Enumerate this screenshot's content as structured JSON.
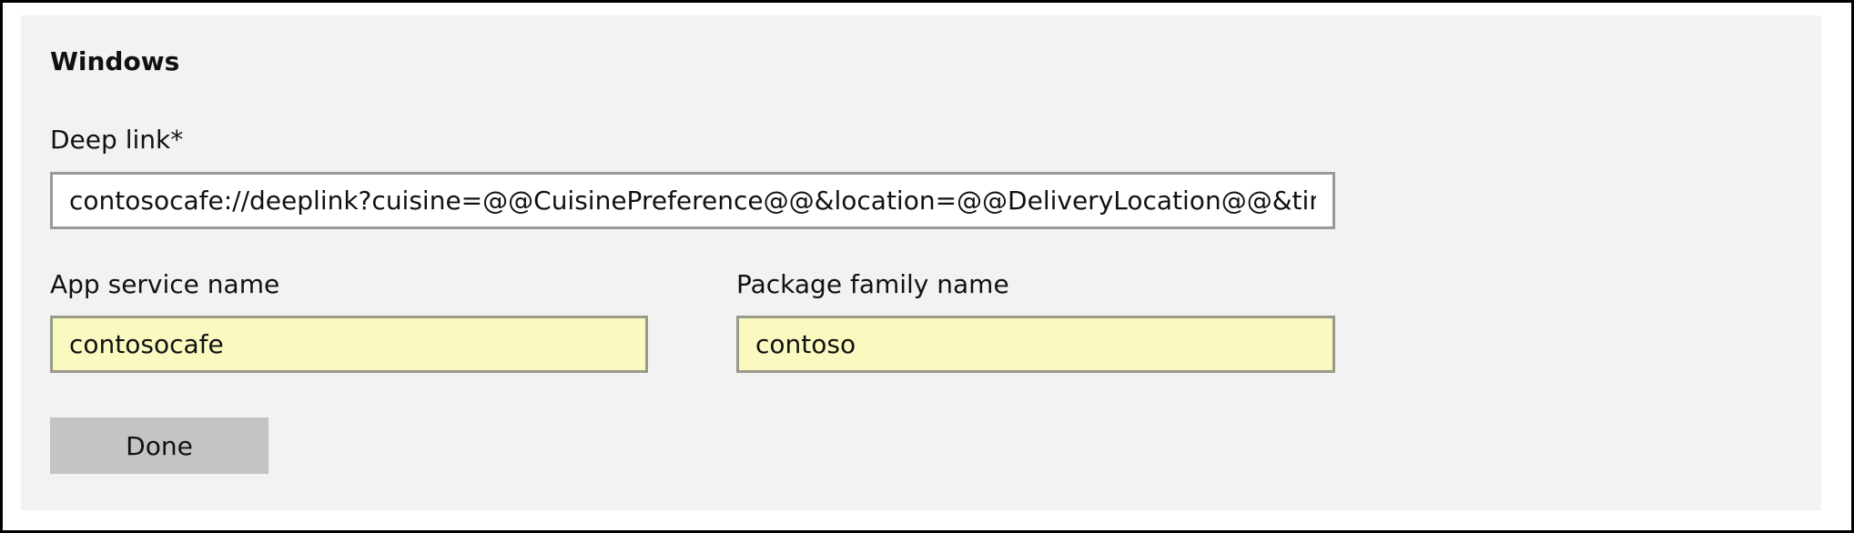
{
  "section": {
    "title": "Windows"
  },
  "fields": {
    "deep_link": {
      "label": "Deep link*",
      "value": "contosocafe://deeplink?cuisine=@@CuisinePreference@@&location=@@DeliveryLocation@@&time=@@DeliveryTime@@"
    },
    "app_service_name": {
      "label": "App service name",
      "value": "contosocafe"
    },
    "package_family_name": {
      "label": "Package family name",
      "value": "contoso"
    }
  },
  "actions": {
    "done_label": "Done"
  },
  "colors": {
    "panel_background": "#f2f2f2",
    "highlighted_input_background": "#fafac0",
    "button_background": "#c4c4c4"
  }
}
